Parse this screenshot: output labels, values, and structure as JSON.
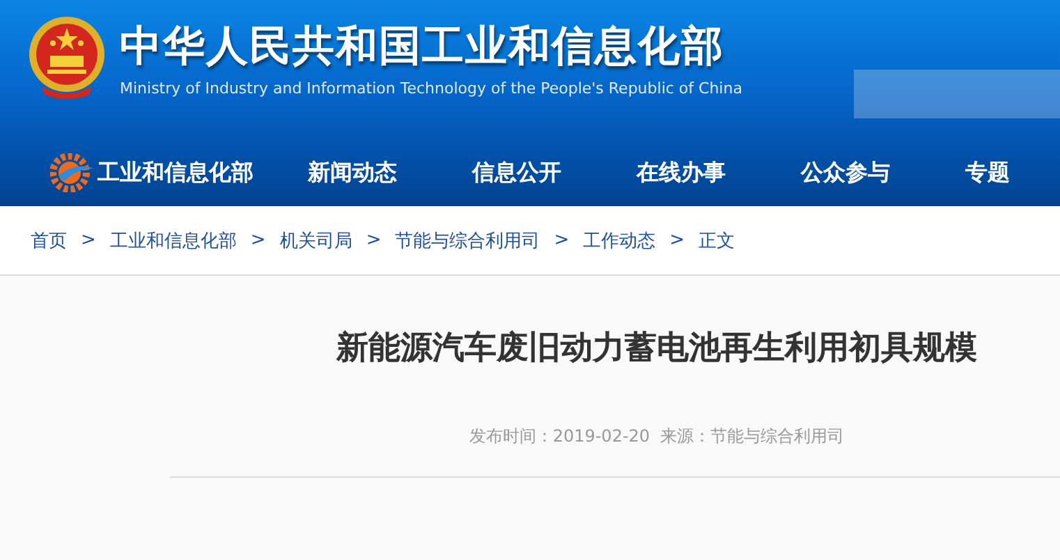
{
  "header": {
    "title": "中华人民共和国工业和信息化部",
    "subtitle": "Ministry of Industry and Information Technology of the People's Republic of China"
  },
  "nav": [
    {
      "label": "工业和信息化部"
    },
    {
      "label": "新闻动态"
    },
    {
      "label": "信息公开"
    },
    {
      "label": "在线办事"
    },
    {
      "label": "公众参与"
    },
    {
      "label": "专题"
    }
  ],
  "breadcrumb": [
    {
      "label": "首页",
      "separator": ">"
    },
    {
      "label": "工业和信息化部",
      "separator": ">"
    },
    {
      "label": "机关司局",
      "separator": ">"
    },
    {
      "label": "节能与综合利用司",
      "separator": ">"
    },
    {
      "label": "工作动态",
      "separator": ">"
    },
    {
      "label": "正文"
    }
  ],
  "article": {
    "title": "新能源汽车废旧动力蓄电池再生利用初具规模",
    "meta": "发布时间：2019-02-20  来源：节能与综合利用司"
  }
}
